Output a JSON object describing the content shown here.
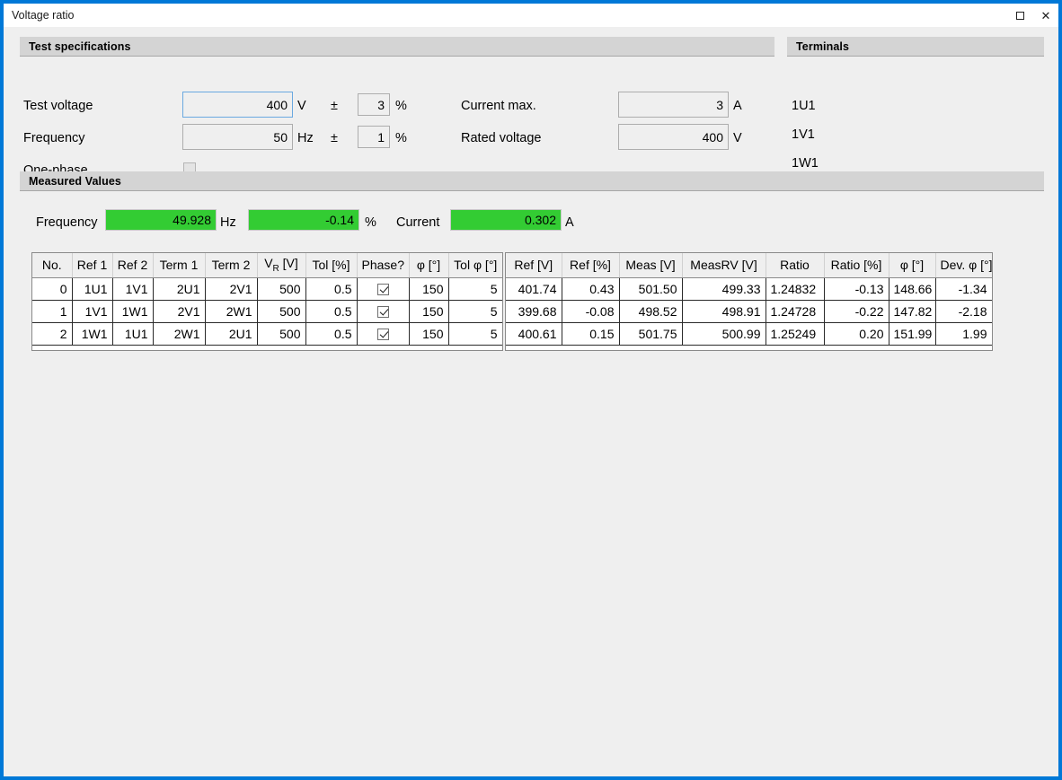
{
  "window": {
    "title": "Voltage ratio",
    "controls": {
      "maximize": "maximize-icon",
      "close": "✕"
    },
    "accent_color": "#0078d7"
  },
  "test_specifications": {
    "header": "Test specifications",
    "fields": {
      "test_voltage": {
        "label": "Test voltage",
        "value": "400",
        "unit": "V",
        "pm": "±",
        "tol_value": "3",
        "tol_unit": "%"
      },
      "frequency": {
        "label": "Frequency",
        "value": "50",
        "unit": "Hz",
        "pm": "±",
        "tol_value": "1",
        "tol_unit": "%"
      },
      "one_phase": {
        "label": "One-phase",
        "checked": false
      },
      "current_max": {
        "label": "Current max.",
        "value": "3",
        "unit": "A"
      },
      "rated_voltage": {
        "label": "Rated voltage",
        "value": "400",
        "unit": "V"
      }
    }
  },
  "terminals": {
    "header": "Terminals",
    "items": [
      "1U1",
      "1V1",
      "1W1"
    ]
  },
  "measured_values": {
    "header": "Measured Values",
    "readouts": [
      {
        "label": "Frequency",
        "value": "49.928",
        "unit": "Hz"
      },
      {
        "label": "",
        "value": "-0.14",
        "unit": "%"
      },
      {
        "label": "Current",
        "value": "0.302",
        "unit": "A"
      }
    ],
    "status_color": "#33cc33"
  },
  "spec_table": {
    "columns": [
      "No.",
      "Ref 1",
      "Ref 2",
      "Term 1",
      "Term 2",
      "V_R [V]",
      "Tol [%]",
      "Phase?",
      "φ [°]",
      "Tol φ [°]"
    ],
    "column_vr_prefix": "V",
    "column_vr_sub": "R",
    "column_vr_suffix": " [V]",
    "rows": [
      {
        "no": "0",
        "ref1": "1U1",
        "ref2": "1V1",
        "term1": "2U1",
        "term2": "2V1",
        "vr": "500",
        "tol": "0.5",
        "phase": true,
        "phi": "150",
        "tolphi": "5"
      },
      {
        "no": "1",
        "ref1": "1V1",
        "ref2": "1W1",
        "term1": "2V1",
        "term2": "2W1",
        "vr": "500",
        "tol": "0.5",
        "phase": true,
        "phi": "150",
        "tolphi": "5"
      },
      {
        "no": "2",
        "ref1": "1W1",
        "ref2": "1U1",
        "term1": "2W1",
        "term2": "2U1",
        "vr": "500",
        "tol": "0.5",
        "phase": true,
        "phi": "150",
        "tolphi": "5"
      }
    ]
  },
  "result_table": {
    "columns": [
      "Ref [V]",
      "Ref [%]",
      "Meas [V]",
      "MeasRV [V]",
      "Ratio",
      "Ratio [%]",
      "φ [°]",
      "Dev. φ [°]"
    ],
    "rows": [
      {
        "ref_v": "401.74",
        "ref_pct": "0.43",
        "meas_v": "501.50",
        "measrv_v": "499.33",
        "ratio": "1.24832",
        "ratio_pct": "-0.13",
        "phi": "148.66",
        "dev_phi": "-1.34"
      },
      {
        "ref_v": "399.68",
        "ref_pct": "-0.08",
        "meas_v": "498.52",
        "measrv_v": "498.91",
        "ratio": "1.24728",
        "ratio_pct": "-0.22",
        "phi": "147.82",
        "dev_phi": "-2.18"
      },
      {
        "ref_v": "400.61",
        "ref_pct": "0.15",
        "meas_v": "501.75",
        "measrv_v": "500.99",
        "ratio": "1.25249",
        "ratio_pct": "0.20",
        "phi": "151.99",
        "dev_phi": "1.99"
      }
    ]
  }
}
